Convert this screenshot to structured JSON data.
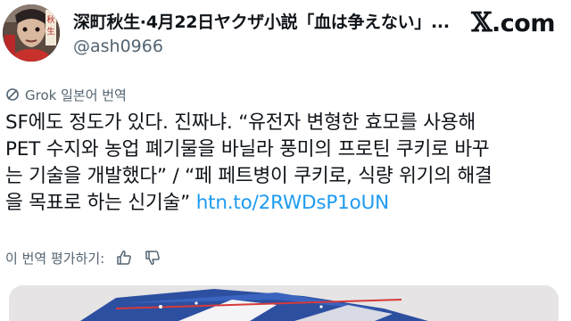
{
  "author": {
    "display_name": "深町秋生·4月22日ヤクザ小説「血は争えない」...",
    "handle": "@ash0966",
    "avatar_icon": "avatar-portrait"
  },
  "brand": {
    "logo_icon": "x-logo-icon",
    "domain_text": ".com"
  },
  "translation": {
    "label": "Grok 일본어 번역",
    "icon": "grok-icon"
  },
  "post": {
    "lines": [
      "SF에도 정도가 있다. 진짜냐. “유전자 변형한 효모를 사용해",
      "PET 수지와 농업 폐기물을 바닐라 풍미의 프로틴 쿠키로 바꾸",
      "는 기술을 개발했다” / “페 페트병이 쿠키로, 식량 위기의 해결",
      "을 목표로 하는 신기술”"
    ],
    "link_text": "htn.to/2RWDsP1oUN"
  },
  "rating": {
    "label": "이 번역 평가하기:",
    "thumbs_up_icon": "thumbs-up-icon",
    "thumbs_down_icon": "thumbs-down-icon"
  },
  "colors": {
    "link": "#1d9bf0",
    "secondary_text": "#536471",
    "primary_text": "#0f1419"
  }
}
